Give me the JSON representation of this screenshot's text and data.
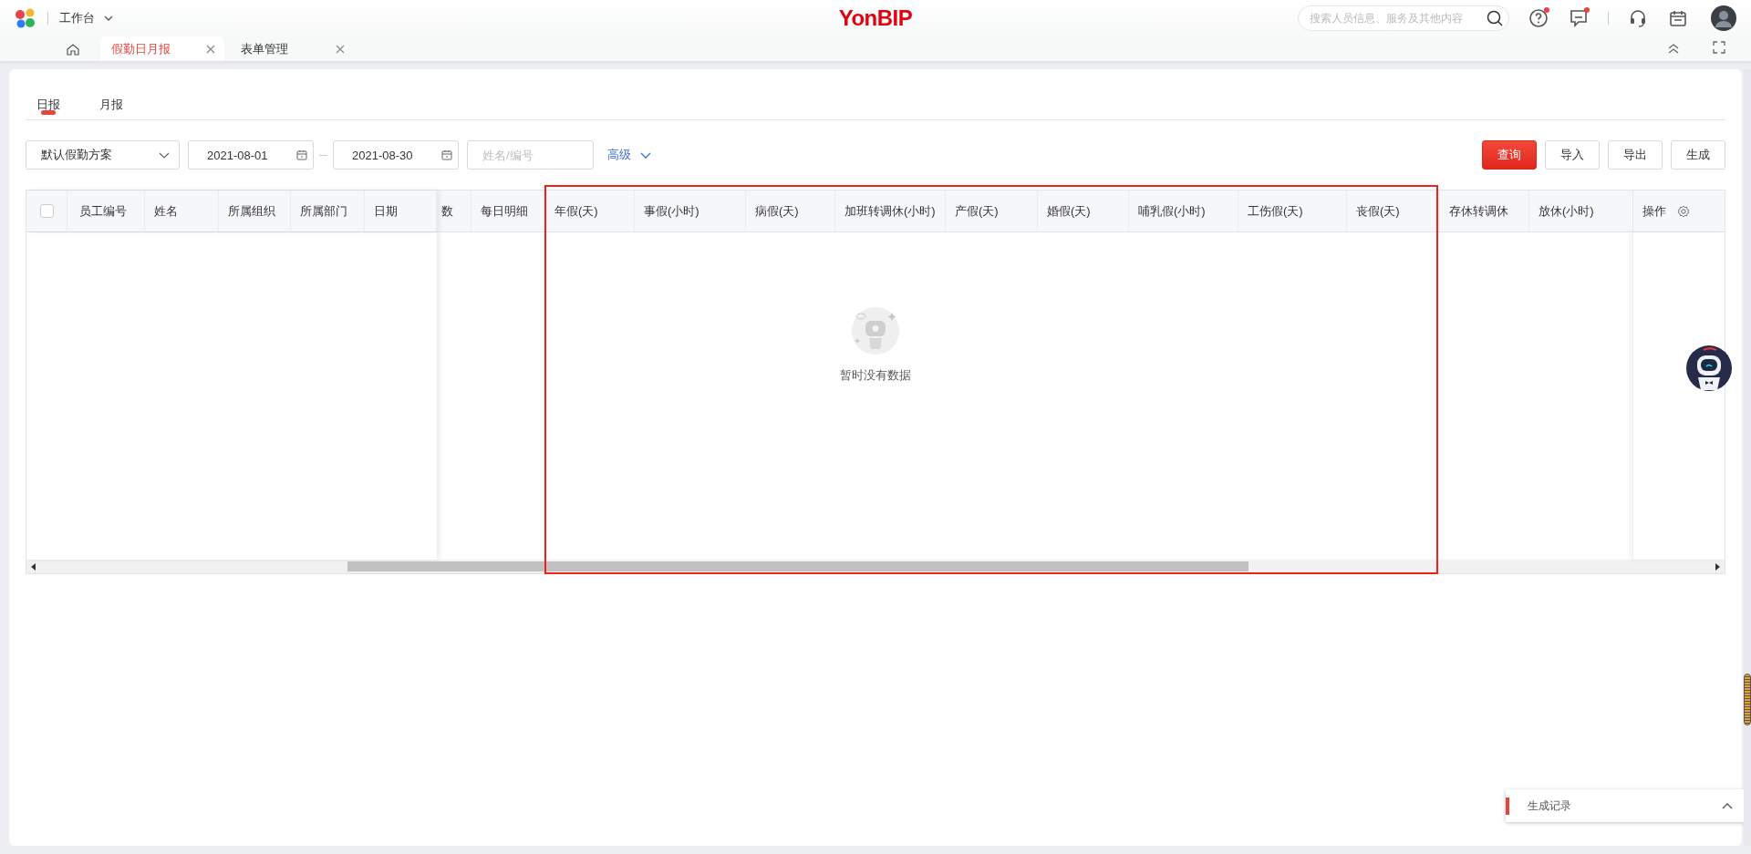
{
  "app_bar": {
    "workspace": "工作台",
    "brand": "YonBIP",
    "search": {
      "placeholder": "搜索人员信息、服务及其他内容"
    },
    "actions": [
      {
        "kind": "help",
        "dot": true
      },
      {
        "kind": "message",
        "dot": true
      },
      {
        "kind": "support",
        "dot": false
      },
      {
        "kind": "calendar",
        "dot": false
      }
    ]
  },
  "tabs": [
    {
      "label": "假勤日月报",
      "selected": true
    },
    {
      "label": "表单管理",
      "selected": false
    }
  ],
  "report_tabs": [
    {
      "label": "日报",
      "selected": true
    },
    {
      "label": "月报",
      "selected": false
    }
  ],
  "filters": {
    "scheme": "默认假勤方案",
    "date_from": "2021-08-01",
    "date_to": "2021-08-30",
    "name_placeholder": "姓名/编号",
    "advanced": "高级"
  },
  "buttons": [
    {
      "label": "查询",
      "primary": true
    },
    {
      "label": "导入",
      "primary": false
    },
    {
      "label": "导出",
      "primary": false
    },
    {
      "label": "生成",
      "primary": false
    }
  ],
  "table": {
    "select_all": {
      "checked": false
    },
    "fixed_columns": [
      "员工编号",
      "姓名",
      "所属组织",
      "所属部门",
      "日期"
    ],
    "columns": [
      "数",
      "每日明细",
      "年假(天)",
      "事假(小时)",
      "病假(天)",
      "加班转调休(小时)",
      "产假(天)",
      "婚假(天)",
      "哺乳假(小时)",
      "工伤假(天)",
      "丧假(天)",
      "存休转调休",
      "放休(小时)"
    ],
    "action_column": "操作",
    "empty_text": "暂时没有数据"
  },
  "generate_log": {
    "label": "生成记录"
  }
}
